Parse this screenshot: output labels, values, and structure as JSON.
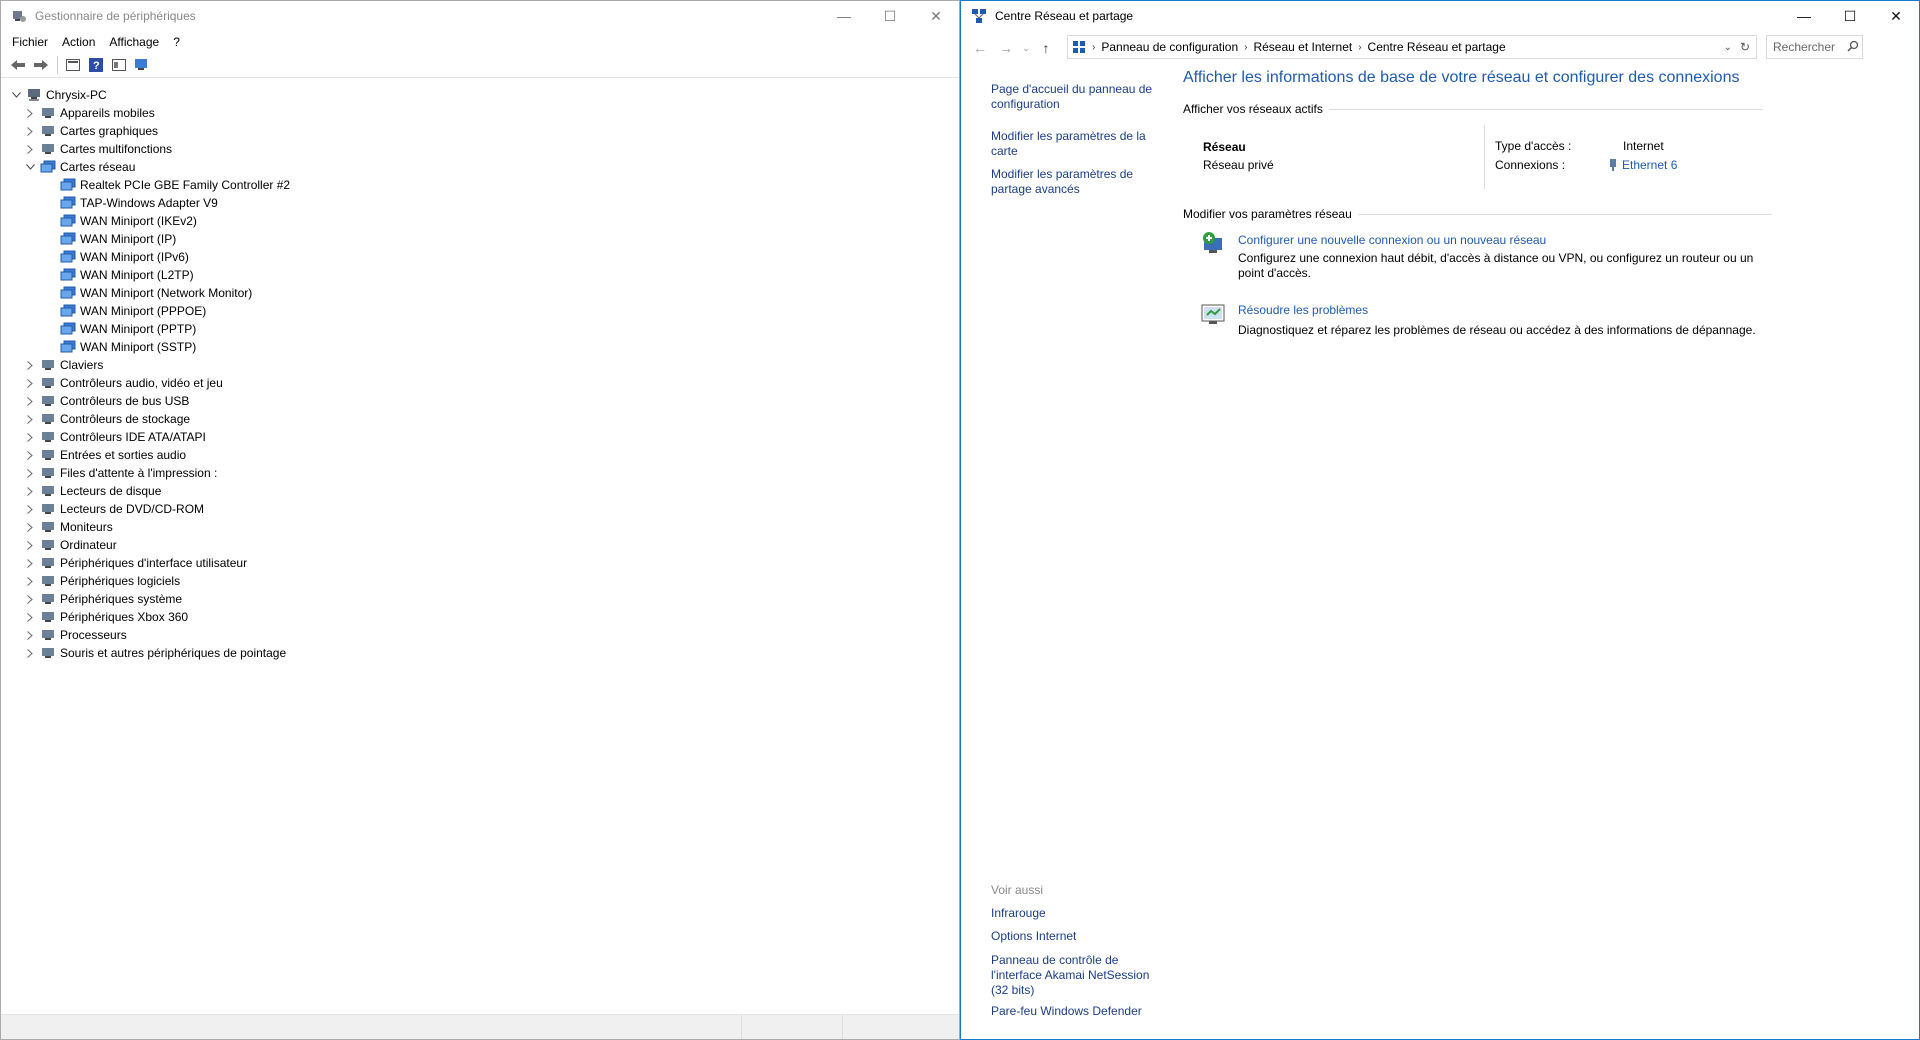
{
  "device_manager": {
    "title": "Gestionnaire de périphériques",
    "menu": [
      "Fichier",
      "Action",
      "Affichage",
      "?"
    ],
    "tree": {
      "root": "Chrysix-PC",
      "categories_before": [
        "Appareils mobiles",
        "Cartes graphiques",
        "Cartes multifonctions"
      ],
      "expanded": {
        "label": "Cartes réseau",
        "children": [
          "Realtek PCIe GBE Family Controller #2",
          "TAP-Windows Adapter V9",
          "WAN Miniport (IKEv2)",
          "WAN Miniport (IP)",
          "WAN Miniport (IPv6)",
          "WAN Miniport (L2TP)",
          "WAN Miniport (Network Monitor)",
          "WAN Miniport (PPPOE)",
          "WAN Miniport (PPTP)",
          "WAN Miniport (SSTP)"
        ]
      },
      "categories_after": [
        "Claviers",
        "Contrôleurs audio, vidéo et jeu",
        "Contrôleurs de bus USB",
        "Contrôleurs de stockage",
        "Contrôleurs IDE ATA/ATAPI",
        "Entrées et sorties audio",
        "Files d'attente à l'impression :",
        "Lecteurs de disque",
        "Lecteurs de DVD/CD-ROM",
        "Moniteurs",
        "Ordinateur",
        "Périphériques d'interface utilisateur",
        "Périphériques logiciels",
        "Périphériques système",
        "Périphériques Xbox 360",
        "Processeurs",
        "Souris et autres périphériques de pointage"
      ]
    }
  },
  "network_center": {
    "title": "Centre Réseau et partage",
    "breadcrumb": [
      "Panneau de configuration",
      "Réseau et Internet",
      "Centre Réseau et partage"
    ],
    "search_placeholder": "Rechercher",
    "left_links": [
      "Page d'accueil du panneau de configuration",
      "Modifier les paramètres de la carte",
      "Modifier les paramètres de partage avancés"
    ],
    "see_also_label": "Voir aussi",
    "see_also": [
      "Infrarouge",
      "Options Internet",
      "Panneau de contrôle de l'interface Akamai NetSession (32 bits)",
      "Pare-feu Windows Defender"
    ],
    "heading": "Afficher les informations de base de votre réseau et configurer des connexions",
    "active_networks_label": "Afficher vos réseaux actifs",
    "network_name": "Réseau",
    "network_type": "Réseau privé",
    "access_type_label": "Type d'accès :",
    "access_type_value": "Internet",
    "connections_label": "Connexions :",
    "connection_value": "Ethernet 6",
    "modify_label": "Modifier vos paramètres réseau",
    "task1_title": "Configurer une nouvelle connexion ou un nouveau réseau",
    "task1_desc": "Configurez une connexion haut débit, d'accès à distance ou VPN, ou configurez un routeur ou un point d'accès.",
    "task2_title": "Résoudre les problèmes",
    "task2_desc": "Diagnostiquez et réparez les problèmes de réseau ou accédez à des informations de dépannage."
  },
  "colors": {
    "link": "#1e5bb0",
    "active_border": "#1979ca"
  },
  "icons": {
    "device_manager": "device-manager-icon",
    "network": "network-center-icon",
    "ethernet": "ethernet-icon",
    "new_connection": "new-connection-icon",
    "troubleshoot": "troubleshoot-icon"
  }
}
